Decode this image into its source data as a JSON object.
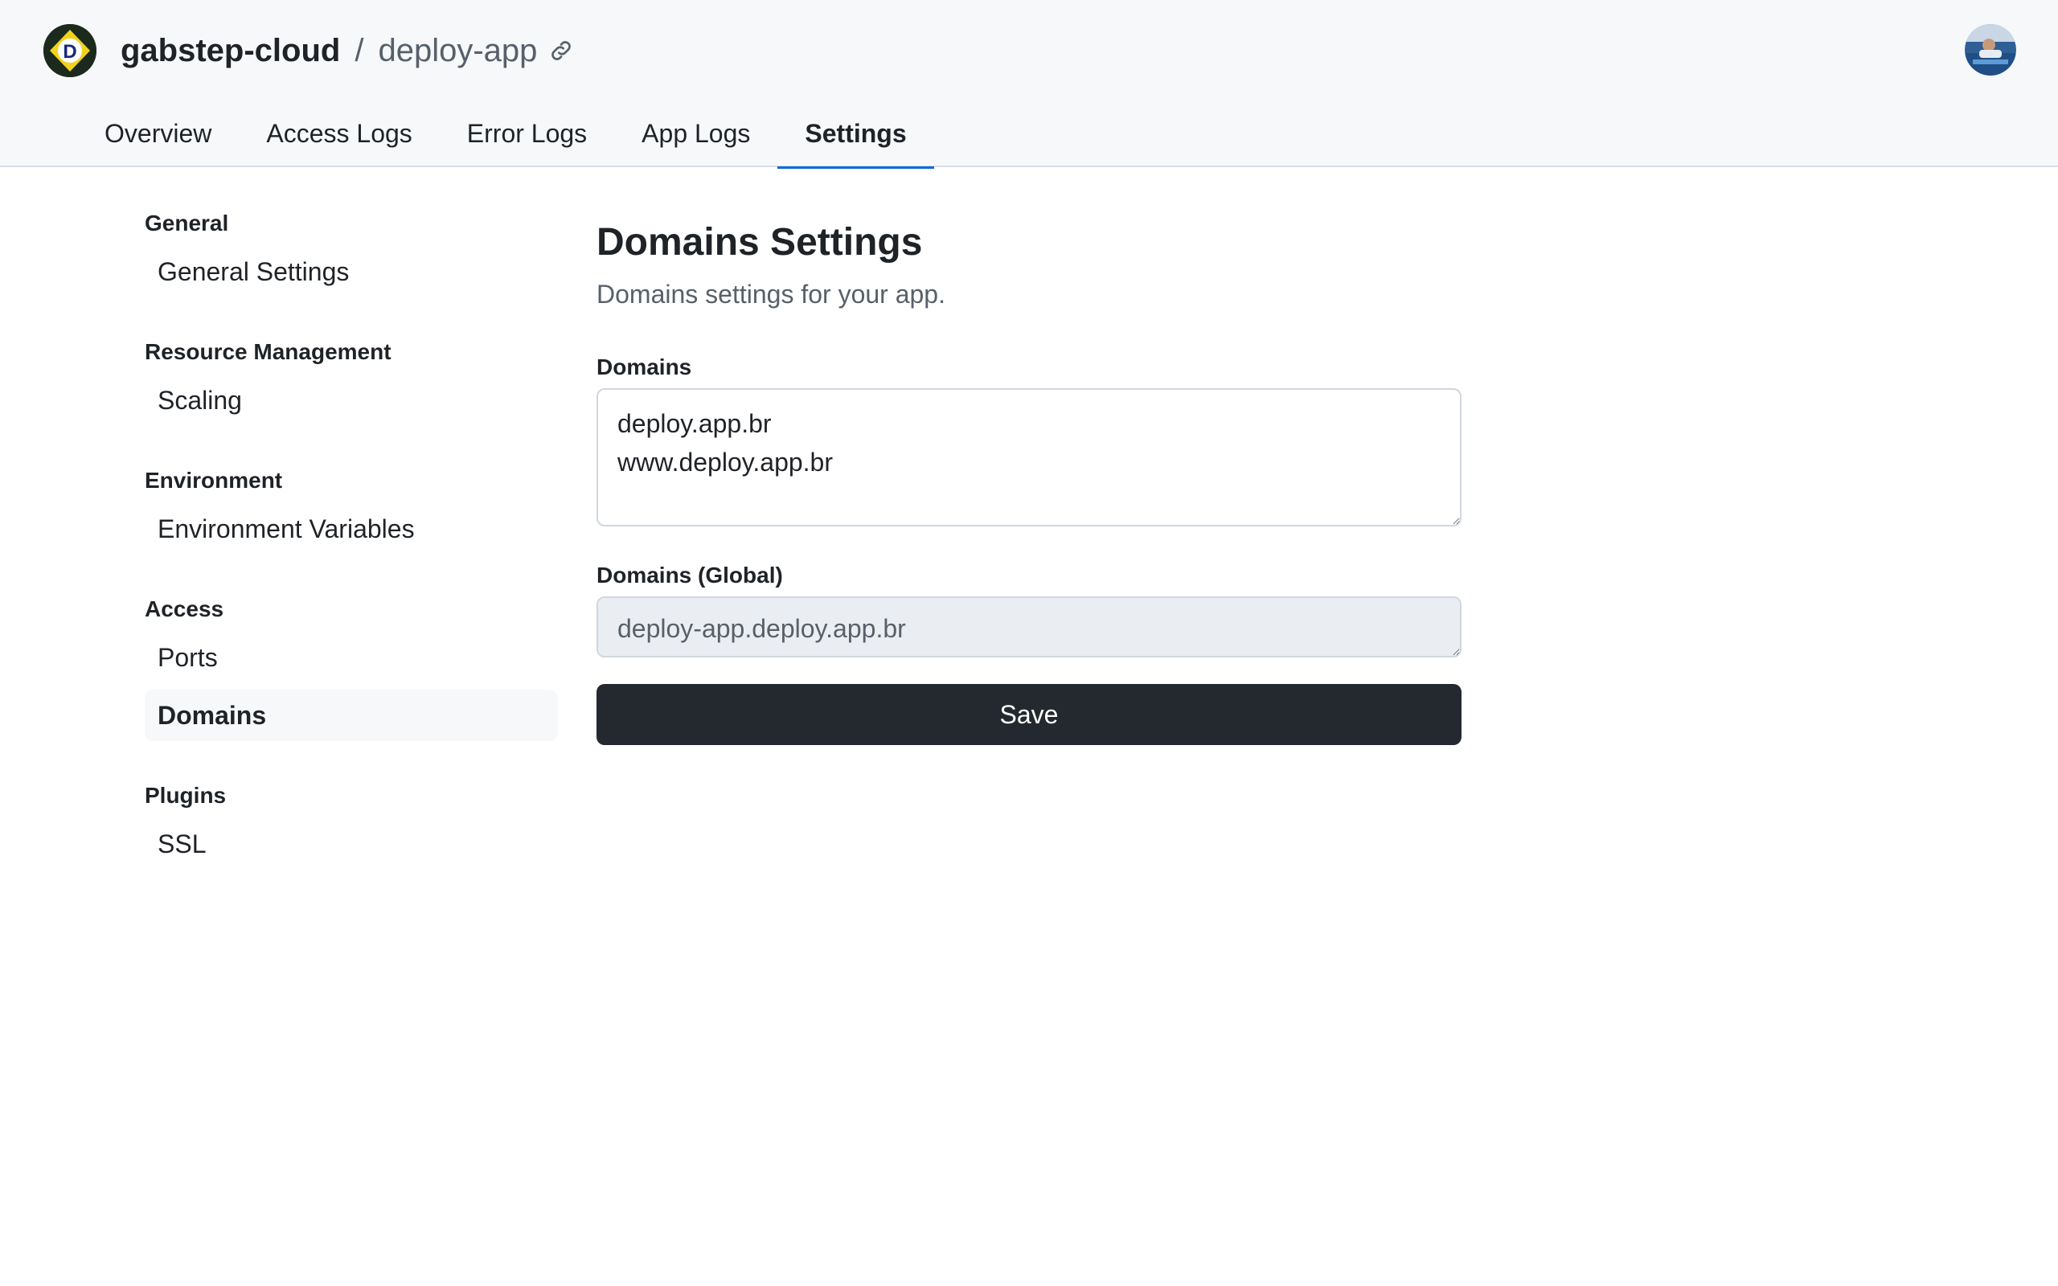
{
  "header": {
    "owner": "gabstep-cloud",
    "separator": "/",
    "repo": "deploy-app",
    "logo_icon": "dokku-logo",
    "link_icon": "link-icon",
    "avatar_icon": "user-avatar"
  },
  "tabs": [
    {
      "label": "Overview",
      "active": false
    },
    {
      "label": "Access Logs",
      "active": false
    },
    {
      "label": "Error Logs",
      "active": false
    },
    {
      "label": "App Logs",
      "active": false
    },
    {
      "label": "Settings",
      "active": true
    }
  ],
  "sidebar": {
    "groups": [
      {
        "title": "General",
        "items": [
          {
            "label": "General Settings"
          }
        ]
      },
      {
        "title": "Resource Management",
        "items": [
          {
            "label": "Scaling"
          }
        ]
      },
      {
        "title": "Environment",
        "items": [
          {
            "label": "Environment Variables"
          }
        ]
      },
      {
        "title": "Access",
        "items": [
          {
            "label": "Ports"
          },
          {
            "label": "Domains",
            "active": true
          }
        ]
      },
      {
        "title": "Plugins",
        "items": [
          {
            "label": "SSL"
          }
        ]
      }
    ]
  },
  "main": {
    "title": "Domains Settings",
    "subtitle": "Domains settings for your app.",
    "domains_label": "Domains",
    "domains_value": "deploy.app.br\nwww.deploy.app.br",
    "global_label": "Domains (Global)",
    "global_value": "deploy-app.deploy.app.br",
    "save_label": "Save"
  },
  "colors": {
    "accent": "#0969da",
    "button_bg": "#24292f",
    "topbar_bg": "#f6f8fa"
  }
}
